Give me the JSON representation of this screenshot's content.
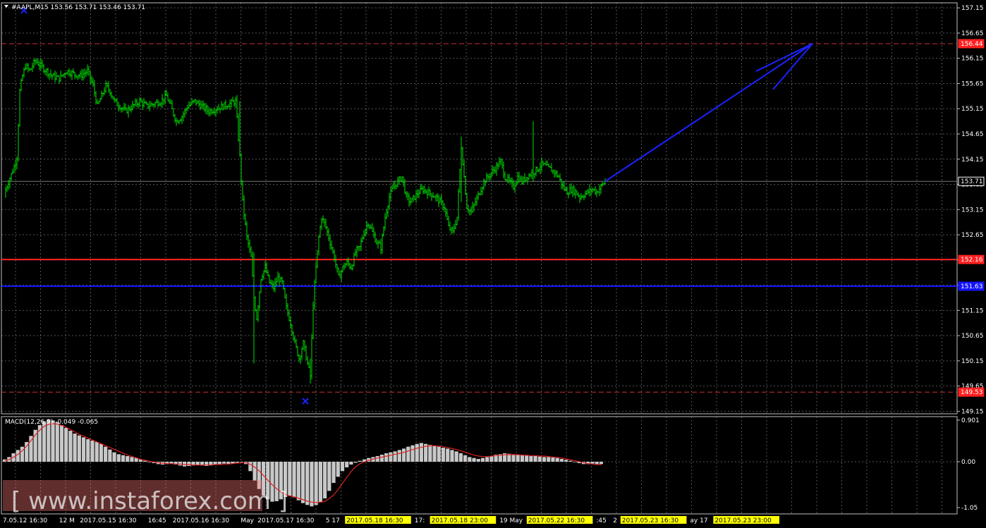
{
  "header": {
    "symbol_line": "#AAPL,M15  153.56 153.71 153.46 153.71"
  },
  "macd_header": "MACD(12,26,9) -0.049 -0.065",
  "watermark": "[ www.instaforex.com ]",
  "colors": {
    "background": "#000000",
    "grid": "#9a9a9a",
    "candles": "#00e000",
    "red_line": "#ff2020",
    "blue_line": "#1414ff",
    "arrow": "#1a22ff",
    "macd_hist": "#c8c8c8",
    "macd_signal": "#e02020",
    "time_highlight": "#ffff00"
  },
  "chart_data": [
    {
      "type": "candlestick",
      "timeframe": "M15",
      "ylim": [
        149.1,
        157.25
      ],
      "y_ticks": [
        "157.15",
        "156.65",
        "156.15",
        "155.65",
        "155.15",
        "154.65",
        "154.15",
        "153.65",
        "153.15",
        "152.65",
        "152.15",
        "151.65",
        "151.15",
        "150.65",
        "150.15",
        "149.65",
        "149.15"
      ],
      "price_badges": [
        {
          "label": "156.44",
          "value": 156.44,
          "color": "#ff2020"
        },
        {
          "label": "153.71",
          "value": 153.71,
          "color": "#000000"
        },
        {
          "label": "152.16",
          "value": 152.16,
          "color": "#ff2020"
        },
        {
          "label": "151.63",
          "value": 151.63,
          "color": "#1414ff"
        },
        {
          "label": "149.53",
          "value": 149.53,
          "color": "#ff2020"
        }
      ],
      "levels": [
        {
          "value": 156.44,
          "style": "dashed",
          "color": "#c83232"
        },
        {
          "value": 152.16,
          "style": "solid",
          "color": "#ff2020"
        },
        {
          "value": 151.63,
          "style": "solid",
          "color": "#1414ff"
        },
        {
          "value": 149.53,
          "style": "dashed",
          "color": "#c83232"
        },
        {
          "value": 153.71,
          "style": "solid",
          "color": "#777777"
        }
      ],
      "close_path": [
        [
          0,
          153.4
        ],
        [
          8,
          153.7
        ],
        [
          16,
          154.0
        ],
        [
          20,
          154.2
        ],
        [
          24,
          155.5
        ],
        [
          28,
          155.8
        ],
        [
          32,
          156.0
        ],
        [
          38,
          155.9
        ],
        [
          46,
          156.1
        ],
        [
          54,
          156.0
        ],
        [
          62,
          155.9
        ],
        [
          70,
          155.8
        ],
        [
          80,
          155.75
        ],
        [
          90,
          155.9
        ],
        [
          100,
          155.85
        ],
        [
          110,
          155.8
        ],
        [
          120,
          155.9
        ],
        [
          128,
          155.6
        ],
        [
          134,
          155.2
        ],
        [
          140,
          155.4
        ],
        [
          146,
          155.6
        ],
        [
          152,
          155.5
        ],
        [
          158,
          155.3
        ],
        [
          166,
          155.2
        ],
        [
          174,
          155.1
        ],
        [
          184,
          155.2
        ],
        [
          194,
          155.3
        ],
        [
          204,
          155.2
        ],
        [
          214,
          155.25
        ],
        [
          224,
          155.3
        ],
        [
          232,
          155.4
        ],
        [
          238,
          155.2
        ],
        [
          246,
          154.9
        ],
        [
          254,
          155.0
        ],
        [
          262,
          155.2
        ],
        [
          272,
          155.3
        ],
        [
          282,
          155.2
        ],
        [
          292,
          155.1
        ],
        [
          302,
          155.15
        ],
        [
          312,
          155.2
        ],
        [
          322,
          155.25
        ],
        [
          330,
          155.3
        ],
        [
          336,
          154.2
        ],
        [
          340,
          153.3
        ],
        [
          346,
          152.6
        ],
        [
          352,
          152.2
        ],
        [
          356,
          151.4
        ],
        [
          360,
          151.0
        ],
        [
          366,
          151.8
        ],
        [
          372,
          152.0
        ],
        [
          378,
          151.7
        ],
        [
          384,
          151.6
        ],
        [
          390,
          151.8
        ],
        [
          396,
          151.7
        ],
        [
          402,
          151.2
        ],
        [
          408,
          150.9
        ],
        [
          414,
          150.5
        ],
        [
          420,
          150.2
        ],
        [
          426,
          150.5
        ],
        [
          432,
          150.1
        ],
        [
          436,
          149.85
        ],
        [
          440,
          151.3
        ],
        [
          444,
          152.0
        ],
        [
          448,
          152.6
        ],
        [
          452,
          153.0
        ],
        [
          458,
          152.8
        ],
        [
          464,
          152.5
        ],
        [
          470,
          152.2
        ],
        [
          476,
          151.8
        ],
        [
          482,
          152.0
        ],
        [
          488,
          152.1
        ],
        [
          494,
          152.0
        ],
        [
          500,
          152.3
        ],
        [
          506,
          152.4
        ],
        [
          512,
          152.7
        ],
        [
          518,
          152.9
        ],
        [
          524,
          152.7
        ],
        [
          530,
          152.5
        ],
        [
          536,
          152.4
        ],
        [
          542,
          153.0
        ],
        [
          548,
          153.4
        ],
        [
          554,
          153.6
        ],
        [
          560,
          153.7
        ],
        [
          566,
          153.8
        ],
        [
          572,
          153.4
        ],
        [
          578,
          153.3
        ],
        [
          584,
          153.4
        ],
        [
          590,
          153.5
        ],
        [
          596,
          153.55
        ],
        [
          602,
          153.5
        ],
        [
          608,
          153.45
        ],
        [
          614,
          153.4
        ],
        [
          620,
          153.3
        ],
        [
          626,
          153.2
        ],
        [
          632,
          152.8
        ],
        [
          638,
          152.7
        ],
        [
          644,
          153.0
        ],
        [
          650,
          154.4
        ],
        [
          654,
          153.8
        ],
        [
          658,
          153.2
        ],
        [
          664,
          153.1
        ],
        [
          670,
          153.3
        ],
        [
          676,
          153.5
        ],
        [
          682,
          153.7
        ],
        [
          688,
          153.8
        ],
        [
          694,
          153.9
        ],
        [
          700,
          154.0
        ],
        [
          706,
          154.1
        ],
        [
          712,
          153.8
        ],
        [
          718,
          153.7
        ],
        [
          724,
          153.6
        ],
        [
          730,
          153.8
        ],
        [
          736,
          153.7
        ],
        [
          742,
          153.8
        ],
        [
          748,
          153.85
        ],
        [
          752,
          153.9
        ],
        [
          758,
          153.95
        ],
        [
          764,
          154.05
        ],
        [
          770,
          154.0
        ],
        [
          776,
          153.95
        ],
        [
          782,
          153.9
        ],
        [
          788,
          153.8
        ],
        [
          794,
          153.6
        ],
        [
          800,
          153.5
        ],
        [
          806,
          153.55
        ],
        [
          812,
          153.5
        ],
        [
          818,
          153.4
        ],
        [
          824,
          153.45
        ],
        [
          830,
          153.5
        ],
        [
          836,
          153.55
        ],
        [
          842,
          153.5
        ],
        [
          848,
          153.6
        ],
        [
          854,
          153.71
        ]
      ],
      "time_labels": [
        {
          "text": "7.05.12 16:30",
          "highlight": false
        },
        {
          "text": "12 M",
          "highlight": false
        },
        {
          "text": "2017.05.15 16:30",
          "highlight": false
        },
        {
          "text": "16:45",
          "highlight": false
        },
        {
          "text": "2017.05.16 16:30",
          "highlight": false
        },
        {
          "text": "May",
          "highlight": false
        },
        {
          "text": "2017.05.17 16:30",
          "highlight": false
        },
        {
          "text": "5 17",
          "highlight": false
        },
        {
          "text": "2017.05.18 16:30",
          "highlight": true
        },
        {
          "text": "17:",
          "highlight": false
        },
        {
          "text": "2017.05.18 23:00",
          "highlight": true
        },
        {
          "text": "19 May",
          "highlight": false
        },
        {
          "text": "2017.05.22 16:30",
          "highlight": true
        },
        {
          "text": ":45",
          "highlight": false
        },
        {
          "text": "2",
          "highlight": false
        },
        {
          "text": "2017.05.23 16:30",
          "highlight": true
        },
        {
          "text": "ay 17",
          "highlight": false
        },
        {
          "text": "2017.05.23 23:00",
          "highlight": true
        }
      ],
      "markers": [
        {
          "shape": "x",
          "price": 157.1,
          "bar_offset": 34,
          "color": "#1a22ff"
        },
        {
          "shape": "x",
          "price": 149.35,
          "bar_offset": 433,
          "color": "#1a22ff"
        }
      ],
      "forecast_arrow": {
        "from_price": 153.71,
        "to_price": 156.44,
        "color": "#1a22ff"
      }
    },
    {
      "type": "bar",
      "name": "MACD(12,26,9)",
      "ylim": [
        -1.05,
        0.901
      ],
      "y_ticks": [
        "0.901",
        "0.00",
        "-1.05"
      ],
      "histogram": [
        0.05,
        0.1,
        0.18,
        0.25,
        0.32,
        0.42,
        0.55,
        0.68,
        0.78,
        0.86,
        0.9,
        0.88,
        0.84,
        0.78,
        0.72,
        0.66,
        0.6,
        0.56,
        0.52,
        0.48,
        0.45,
        0.42,
        0.38,
        0.32,
        0.26,
        0.2,
        0.16,
        0.14,
        0.12,
        0.1,
        0.08,
        0.05,
        0.02,
        -0.01,
        -0.03,
        -0.05,
        -0.06,
        -0.05,
        -0.04,
        -0.06,
        -0.08,
        -0.1,
        -0.09,
        -0.08,
        -0.07,
        -0.08,
        -0.09,
        -0.08,
        -0.06,
        -0.05,
        -0.04,
        -0.05,
        -0.04,
        -0.02,
        -0.01,
        -0.05,
        -0.2,
        -0.4,
        -0.58,
        -0.72,
        -0.8,
        -0.85,
        -0.84,
        -0.8,
        -0.75,
        -0.72,
        -0.76,
        -0.82,
        -0.88,
        -0.92,
        -0.95,
        -0.92,
        -0.86,
        -0.78,
        -0.62,
        -0.45,
        -0.32,
        -0.2,
        -0.12,
        -0.06,
        -0.02,
        0.02,
        0.05,
        0.08,
        0.1,
        0.12,
        0.15,
        0.18,
        0.2,
        0.22,
        0.25,
        0.28,
        0.32,
        0.35,
        0.38,
        0.4,
        0.38,
        0.36,
        0.34,
        0.32,
        0.3,
        0.28,
        0.25,
        0.22,
        0.18,
        0.14,
        0.1,
        0.08,
        0.06,
        0.08,
        0.1,
        0.12,
        0.15,
        0.16,
        0.18,
        0.17,
        0.16,
        0.15,
        0.14,
        0.13,
        0.12,
        0.12,
        0.11,
        0.1,
        0.1,
        0.09,
        0.08,
        0.06,
        0.04,
        0.02,
        -0.01,
        -0.03,
        -0.05,
        -0.05,
        -0.04,
        -0.05,
        -0.049
      ],
      "signal": [
        0.02,
        0.05,
        0.1,
        0.16,
        0.24,
        0.34,
        0.46,
        0.58,
        0.68,
        0.76,
        0.8,
        0.81,
        0.8,
        0.77,
        0.73,
        0.68,
        0.63,
        0.58,
        0.54,
        0.5,
        0.46,
        0.42,
        0.38,
        0.34,
        0.3,
        0.26,
        0.22,
        0.18,
        0.14,
        0.11,
        0.08,
        0.05,
        0.03,
        0.01,
        -0.01,
        -0.02,
        -0.03,
        -0.04,
        -0.04,
        -0.05,
        -0.05,
        -0.06,
        -0.06,
        -0.07,
        -0.07,
        -0.07,
        -0.07,
        -0.07,
        -0.06,
        -0.06,
        -0.05,
        -0.05,
        -0.04,
        -0.03,
        -0.02,
        -0.02,
        -0.06,
        -0.12,
        -0.2,
        -0.3,
        -0.4,
        -0.5,
        -0.58,
        -0.65,
        -0.7,
        -0.73,
        -0.75,
        -0.78,
        -0.81,
        -0.84,
        -0.86,
        -0.87,
        -0.86,
        -0.84,
        -0.78,
        -0.7,
        -0.58,
        -0.45,
        -0.32,
        -0.2,
        -0.1,
        -0.04,
        0.0,
        0.03,
        0.06,
        0.08,
        0.1,
        0.12,
        0.14,
        0.16,
        0.18,
        0.2,
        0.23,
        0.26,
        0.29,
        0.31,
        0.33,
        0.34,
        0.34,
        0.33,
        0.32,
        0.3,
        0.28,
        0.26,
        0.23,
        0.2,
        0.17,
        0.14,
        0.12,
        0.11,
        0.11,
        0.12,
        0.13,
        0.14,
        0.15,
        0.15,
        0.15,
        0.15,
        0.14,
        0.14,
        0.13,
        0.13,
        0.12,
        0.12,
        0.11,
        0.1,
        0.09,
        0.08,
        0.06,
        0.04,
        0.02,
        0.0,
        -0.02,
        -0.04,
        -0.05,
        -0.06,
        -0.065
      ]
    }
  ]
}
